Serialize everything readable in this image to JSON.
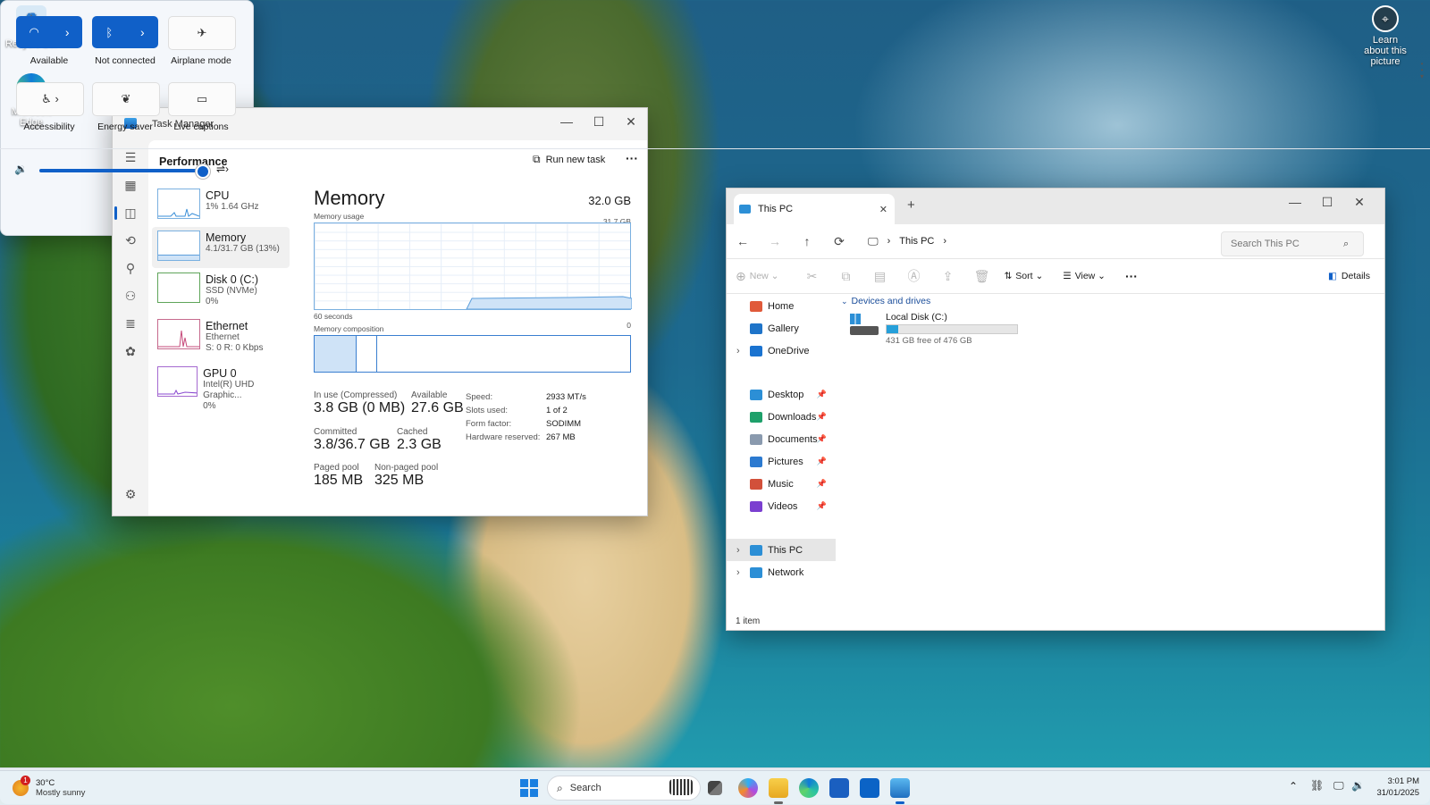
{
  "desktop": {
    "icons": [
      {
        "label": "Recycle Bin",
        "icon": "recycle-bin-icon"
      },
      {
        "label": "Microsoft Edge",
        "icon": "edge-icon"
      },
      {
        "label": "Learn about this picture",
        "icon": "camera-icon"
      }
    ]
  },
  "task_manager": {
    "title": "Task Manager",
    "section": "Performance",
    "run_new_task": "Run new task",
    "more": "···",
    "perf_items": [
      {
        "name": "CPU",
        "sub1": "1% 1.64 GHz",
        "sub2": ""
      },
      {
        "name": "Memory",
        "sub1": "4.1/31.7 GB (13%)",
        "sub2": ""
      },
      {
        "name": "Disk 0 (C:)",
        "sub1": "SSD (NVMe)",
        "sub2": "0%"
      },
      {
        "name": "Ethernet",
        "sub1": "Ethernet",
        "sub2": "S: 0 R: 0 Kbps"
      },
      {
        "name": "GPU 0",
        "sub1": "Intel(R) UHD Graphic...",
        "sub2": "0%"
      }
    ],
    "detail": {
      "title": "Memory",
      "total": "32.0 GB",
      "usage_label": "Memory usage",
      "usage_max": "31.7 GB",
      "time_label": "60 seconds",
      "time_end": "0",
      "composition_label": "Memory composition",
      "stats": {
        "in_use_label": "In use (Compressed)",
        "in_use": "3.8 GB (0 MB)",
        "available_label": "Available",
        "available": "27.6 GB",
        "committed_label": "Committed",
        "committed": "3.8/36.7 GB",
        "cached_label": "Cached",
        "cached": "2.3 GB",
        "paged_label": "Paged pool",
        "paged": "185 MB",
        "nonpaged_label": "Non-paged pool",
        "nonpaged": "325 MB"
      },
      "specs": [
        {
          "label": "Speed:",
          "value": "2933 MT/s"
        },
        {
          "label": "Slots used:",
          "value": "1 of 2"
        },
        {
          "label": "Form factor:",
          "value": "SODIMM"
        },
        {
          "label": "Hardware reserved:",
          "value": "267 MB"
        }
      ]
    }
  },
  "explorer": {
    "tab_title": "This PC",
    "breadcrumb": "This PC",
    "search_placeholder": "Search This PC",
    "toolbar": {
      "new": "New",
      "sort": "Sort",
      "view": "View",
      "details": "Details"
    },
    "sidebar": [
      {
        "label": "Home",
        "icon": "home-icon",
        "color": "#e05a3a",
        "pinned": false,
        "expand": false
      },
      {
        "label": "Gallery",
        "icon": "gallery-icon",
        "color": "#1f74c9",
        "pinned": false,
        "expand": false
      },
      {
        "label": "OneDrive",
        "icon": "onedrive-icon",
        "color": "#1a73d0",
        "pinned": false,
        "expand": true
      },
      {
        "label": "Desktop",
        "icon": "desktop-icon",
        "color": "#2c8fd6",
        "pinned": true,
        "expand": false
      },
      {
        "label": "Downloads",
        "icon": "downloads-icon",
        "color": "#1ea06a",
        "pinned": true,
        "expand": false
      },
      {
        "label": "Documents",
        "icon": "documents-icon",
        "color": "#8a9aae",
        "pinned": true,
        "expand": false
      },
      {
        "label": "Pictures",
        "icon": "pictures-icon",
        "color": "#2c7ad0",
        "pinned": true,
        "expand": false
      },
      {
        "label": "Music",
        "icon": "music-icon",
        "color": "#d2503a",
        "pinned": true,
        "expand": false
      },
      {
        "label": "Videos",
        "icon": "videos-icon",
        "color": "#7b3fd0",
        "pinned": true,
        "expand": false
      },
      {
        "label": "This PC",
        "icon": "this-pc-icon",
        "color": "#2c8fd6",
        "pinned": false,
        "expand": true
      },
      {
        "label": "Network",
        "icon": "network-icon",
        "color": "#2c8fd6",
        "pinned": false,
        "expand": true
      }
    ],
    "group": "Devices and drives",
    "drive": {
      "name": "Local Disk (C:)",
      "free": "431 GB free of 476 GB",
      "used_fraction": 0.09
    },
    "status": "1 item"
  },
  "quick_settings": {
    "tiles": [
      {
        "label": "Available",
        "icon": "wifi-icon",
        "on": true
      },
      {
        "label": "Not connected",
        "icon": "bluetooth-icon",
        "on": true
      },
      {
        "label": "Airplane mode",
        "icon": "airplane-icon",
        "on": false
      },
      {
        "label": "Accessibility",
        "icon": "accessibility-icon",
        "on": false
      },
      {
        "label": "Energy saver",
        "icon": "energy-saver-icon",
        "on": false
      },
      {
        "label": "Live captions",
        "icon": "live-captions-icon",
        "on": false
      }
    ],
    "volume_fraction": 0.99
  },
  "taskbar": {
    "weather_temp": "30°C",
    "weather_desc": "Mostly sunny",
    "weather_badge": "1",
    "search": "Search",
    "time": "3:01 PM",
    "date": "31/01/2025"
  },
  "colors": {
    "accent": "#1060c8",
    "memory_graph": "#7ab0e0"
  }
}
